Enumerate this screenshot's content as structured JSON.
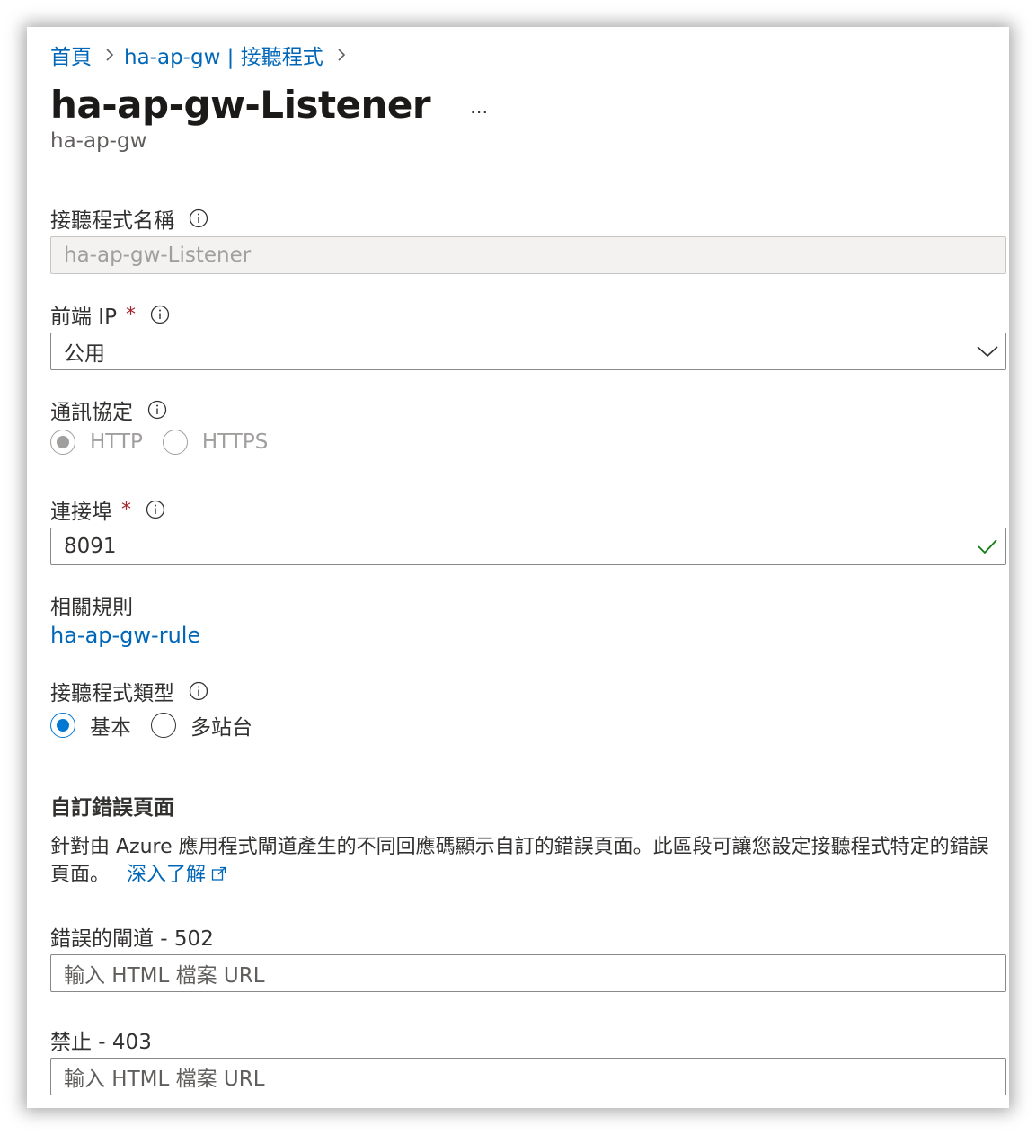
{
  "breadcrumb": {
    "home": "首頁",
    "parent": "ha-ap-gw | 接聽程式"
  },
  "header": {
    "title": "ha-ap-gw-Listener",
    "more": "…",
    "subtitle": "ha-ap-gw"
  },
  "listener_name": {
    "label": "接聽程式名稱",
    "value": "ha-ap-gw-Listener",
    "disabled": true
  },
  "frontend_ip": {
    "label": "前端 IP",
    "required_mark": "*",
    "value": "公用"
  },
  "protocol": {
    "label": "通訊協定",
    "options": [
      "HTTP",
      "HTTPS"
    ],
    "selected": "HTTP",
    "disabled": true
  },
  "port": {
    "label": "連接埠",
    "required_mark": "*",
    "value": "8091",
    "valid": true
  },
  "related_rule": {
    "label": "相關規則",
    "link": "ha-ap-gw-rule"
  },
  "listener_type": {
    "label": "接聽程式類型",
    "options": [
      "基本",
      "多站台"
    ],
    "selected": "基本"
  },
  "custom_errors": {
    "title": "自訂錯誤頁面",
    "description": "針對由 Azure 應用程式閘道產生的不同回應碼顯示自訂的錯誤頁面。此區段可讓您設定接聽程式特定的錯誤頁面。",
    "learn_more": "深入了解",
    "fields": [
      {
        "label": "錯誤的閘道 - 502",
        "placeholder": "輸入 HTML 檔案 URL"
      },
      {
        "label": "禁止 - 403",
        "placeholder": "輸入 HTML 檔案 URL"
      }
    ]
  },
  "colors": {
    "link": "#0067b8",
    "accent": "#0078d4",
    "required": "#a4262c",
    "valid": "#107c10"
  },
  "icons": [
    "chevron-right-icon",
    "more-icon",
    "info-icon",
    "chevron-down-icon",
    "checkmark-icon",
    "external-link-icon"
  ]
}
